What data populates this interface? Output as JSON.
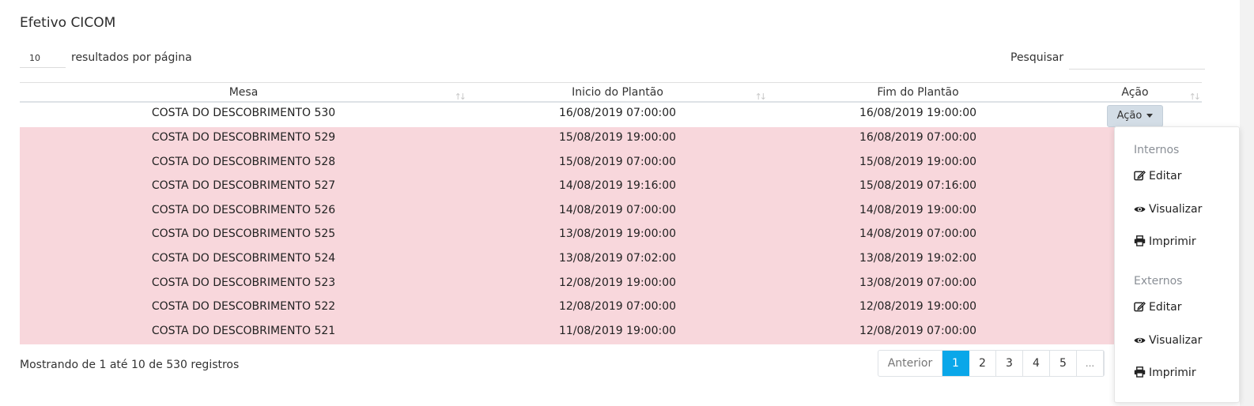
{
  "card": {
    "title": "Efetivo CICOM"
  },
  "length_menu": {
    "value": "10",
    "label": "resultados por página"
  },
  "search": {
    "label": "Pesquisar",
    "value": ""
  },
  "table": {
    "columns": [
      "Mesa",
      "Inicio do Plantão",
      "Fim do Plantão",
      "Ação"
    ],
    "action_button_label": "Ação",
    "row_highlight_color": "#f8d7dc",
    "rows": [
      {
        "mesa": "COSTA DO DESCOBRIMENTO 530",
        "inicio": "16/08/2019 07:00:00",
        "fim": "16/08/2019 19:00:00",
        "highlight": false
      },
      {
        "mesa": "COSTA DO DESCOBRIMENTO 529",
        "inicio": "15/08/2019 19:00:00",
        "fim": "16/08/2019 07:00:00",
        "highlight": true
      },
      {
        "mesa": "COSTA DO DESCOBRIMENTO 528",
        "inicio": "15/08/2019 07:00:00",
        "fim": "15/08/2019 19:00:00",
        "highlight": true
      },
      {
        "mesa": "COSTA DO DESCOBRIMENTO 527",
        "inicio": "14/08/2019 19:16:00",
        "fim": "15/08/2019 07:16:00",
        "highlight": true
      },
      {
        "mesa": "COSTA DO DESCOBRIMENTO 526",
        "inicio": "14/08/2019 07:00:00",
        "fim": "14/08/2019 19:00:00",
        "highlight": true
      },
      {
        "mesa": "COSTA DO DESCOBRIMENTO 525",
        "inicio": "13/08/2019 19:00:00",
        "fim": "14/08/2019 07:00:00",
        "highlight": true
      },
      {
        "mesa": "COSTA DO DESCOBRIMENTO 524",
        "inicio": "13/08/2019 07:02:00",
        "fim": "13/08/2019 19:02:00",
        "highlight": true
      },
      {
        "mesa": "COSTA DO DESCOBRIMENTO 523",
        "inicio": "12/08/2019 19:00:00",
        "fim": "13/08/2019 07:00:00",
        "highlight": true
      },
      {
        "mesa": "COSTA DO DESCOBRIMENTO 522",
        "inicio": "12/08/2019 07:00:00",
        "fim": "12/08/2019 19:00:00",
        "highlight": true
      },
      {
        "mesa": "COSTA DO DESCOBRIMENTO 521",
        "inicio": "11/08/2019 19:00:00",
        "fim": "12/08/2019 07:00:00",
        "highlight": true
      }
    ]
  },
  "info": {
    "text": "Mostrando de 1 até 10 de 530 registros"
  },
  "pagination": {
    "previous_label": "Anterior",
    "pages": [
      "1",
      "2",
      "3",
      "4",
      "5"
    ],
    "active_page": "1",
    "ellipsis": "...",
    "active_color": "#0aa7e9"
  },
  "dropdown": {
    "sections": [
      {
        "header": "Internos",
        "items": [
          {
            "label": "Editar",
            "icon": "edit-icon"
          },
          {
            "label": "Visualizar",
            "icon": "eye-icon"
          },
          {
            "label": "Imprimir",
            "icon": "print-icon"
          }
        ]
      },
      {
        "header": "Externos",
        "items": [
          {
            "label": "Editar",
            "icon": "edit-icon"
          },
          {
            "label": "Visualizar",
            "icon": "eye-icon"
          },
          {
            "label": "Imprimir",
            "icon": "print-icon"
          }
        ]
      }
    ]
  }
}
